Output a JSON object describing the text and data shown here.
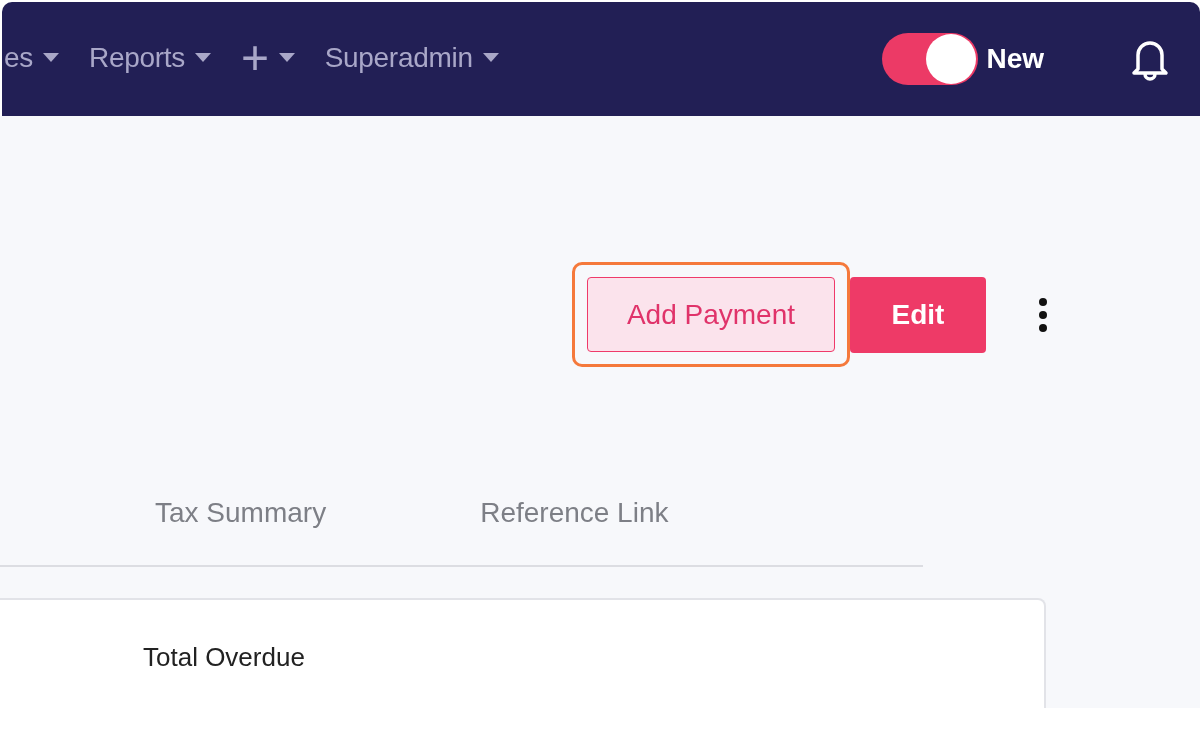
{
  "nav": {
    "items": [
      {
        "label": "es",
        "kind": "menu"
      },
      {
        "label": "Reports",
        "kind": "menu"
      },
      {
        "label": "+",
        "kind": "add"
      },
      {
        "label": "Superadmin",
        "kind": "menu"
      }
    ],
    "toggle": {
      "label": "New",
      "on": true
    }
  },
  "actions": {
    "primary": "Add Payment",
    "secondary": "Edit",
    "highlighted": true
  },
  "tabs": [
    {
      "label": "Tax Summary",
      "selected": false
    },
    {
      "label": "Reference Link",
      "selected": false
    }
  ],
  "card": {
    "label": "Total Overdue"
  }
}
